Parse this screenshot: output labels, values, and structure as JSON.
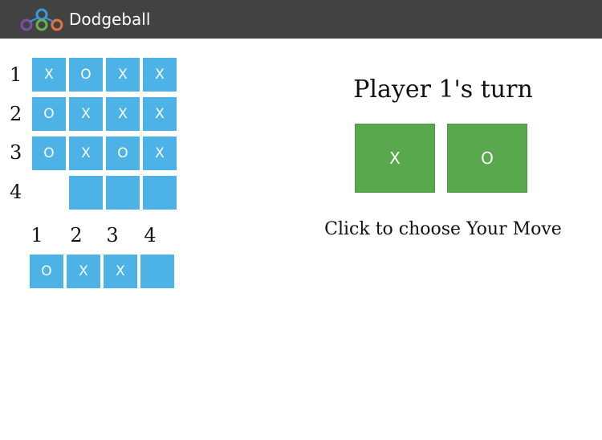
{
  "header": {
    "app_name": "Dodgeball",
    "logo_colors": [
      "#7b4fa3",
      "#3a9ad9",
      "#6bb24a",
      "#e8743b"
    ]
  },
  "board": {
    "row_labels": [
      "1",
      "2",
      "3",
      "4"
    ],
    "rows": [
      [
        "X",
        "O",
        "X",
        "X"
      ],
      [
        "O",
        "X",
        "X",
        "X"
      ],
      [
        "O",
        "X",
        "O",
        "X"
      ],
      [
        "",
        "",
        "",
        ""
      ]
    ],
    "row4_first_cell_present": false
  },
  "opponent_row": {
    "column_labels": [
      "1",
      "2",
      "3",
      "4"
    ],
    "cells": [
      "O",
      "X",
      "X",
      ""
    ]
  },
  "turn": {
    "title": "Player 1's turn",
    "choices": [
      "X",
      "O"
    ],
    "instruction": "Click to choose Your Move"
  },
  "colors": {
    "cell": "#4db3e6",
    "button": "#5aa84e",
    "header": "#424242"
  }
}
